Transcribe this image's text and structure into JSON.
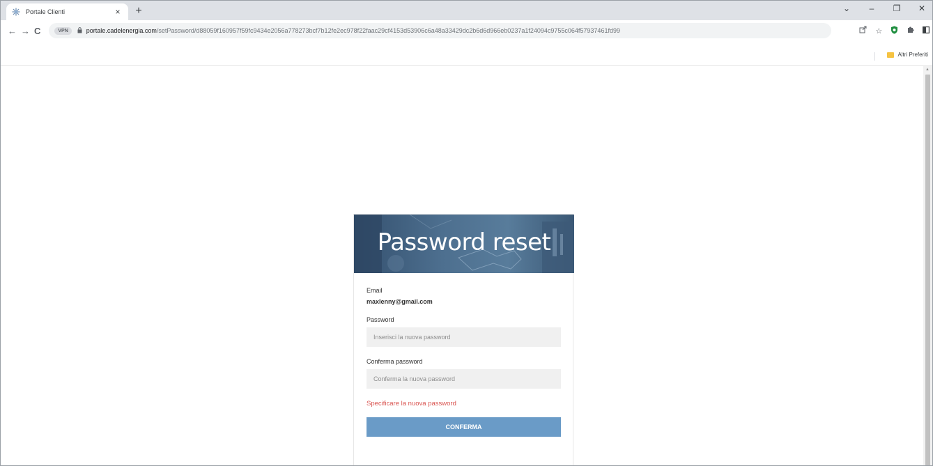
{
  "browser": {
    "tab_title": "Portale Clienti",
    "tab_close": "×",
    "new_tab": "+",
    "window_controls": {
      "tab_search": "⌄",
      "minimize": "–",
      "restore": "❐",
      "close": "✕"
    },
    "nav": {
      "back": "←",
      "forward": "→",
      "reload": "C"
    },
    "vpn_badge": "VPN",
    "url_host": "portale.cadelenergia.com",
    "url_path": "/setPassword/d88059f160957f59fc9434e2056a778273bcf7b12fe2ec978f22faac29cf4153d53906c6a48a33429dc2b6d6d966eb0237a1f24094c9755c064f57937461fd99",
    "bookmarks_other": "Altri Preferiti",
    "icons": [
      "share-icon",
      "star-icon",
      "shield-extension-icon",
      "puzzle-icon",
      "sidebar-icon",
      "profile-icon",
      "shield-check-icon",
      "menu-icon"
    ]
  },
  "card": {
    "title": "Password reset",
    "email_label": "Email",
    "email_value": "maxlenny@gmail.com",
    "password_label": "Password",
    "password_placeholder": "Inserisci la nuova password",
    "confirm_label": "Conferma password",
    "confirm_placeholder": "Conferma la nuova password",
    "error": "Specificare la nuova password",
    "submit_label": "CONFERMA"
  },
  "colors": {
    "accent_button": "#6a9bc7",
    "error": "#d9534f",
    "hero": "#4d6f8f"
  }
}
